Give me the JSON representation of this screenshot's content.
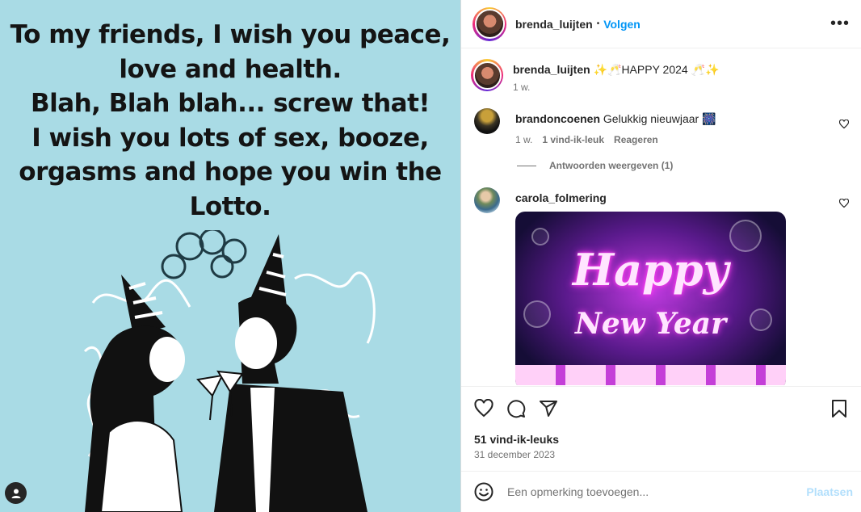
{
  "media": {
    "quote_lines": [
      "To my friends, I wish you peace,",
      "love and health.",
      "Blah, Blah blah... screw that!",
      "I wish you lots of sex, booze,",
      "orgasms and hope you win the",
      "Lotto."
    ],
    "background_color": "#a9dbe5"
  },
  "header": {
    "username": "brenda_luijten",
    "separator": "•",
    "follow_label": "Volgen",
    "more_label": "•••"
  },
  "caption": {
    "username": "brenda_luijten",
    "text": "✨🥂HAPPY 2024 🥂✨",
    "time": "1 w."
  },
  "comments": [
    {
      "username": "brandoncoenen",
      "text": "Gelukkig nieuwjaar 🎆",
      "time": "1 w.",
      "likes": "1 vind-ik-leuk",
      "reply_label": "Reageren",
      "view_replies": "Antwoorden weergeven (1)"
    },
    {
      "username": "carola_folmering",
      "gif_line1": "Happy",
      "gif_line2": "New Year"
    }
  ],
  "actions": {
    "likes_count": "51 vind-ik-leuks",
    "date": "31 december 2023"
  },
  "composer": {
    "placeholder": "Een opmerking toevoegen...",
    "post_label": "Plaatsen"
  },
  "colors": {
    "accent": "#0095f6",
    "post_disabled": "#b2dffc",
    "text_primary": "#262626",
    "text_secondary": "#737373"
  }
}
